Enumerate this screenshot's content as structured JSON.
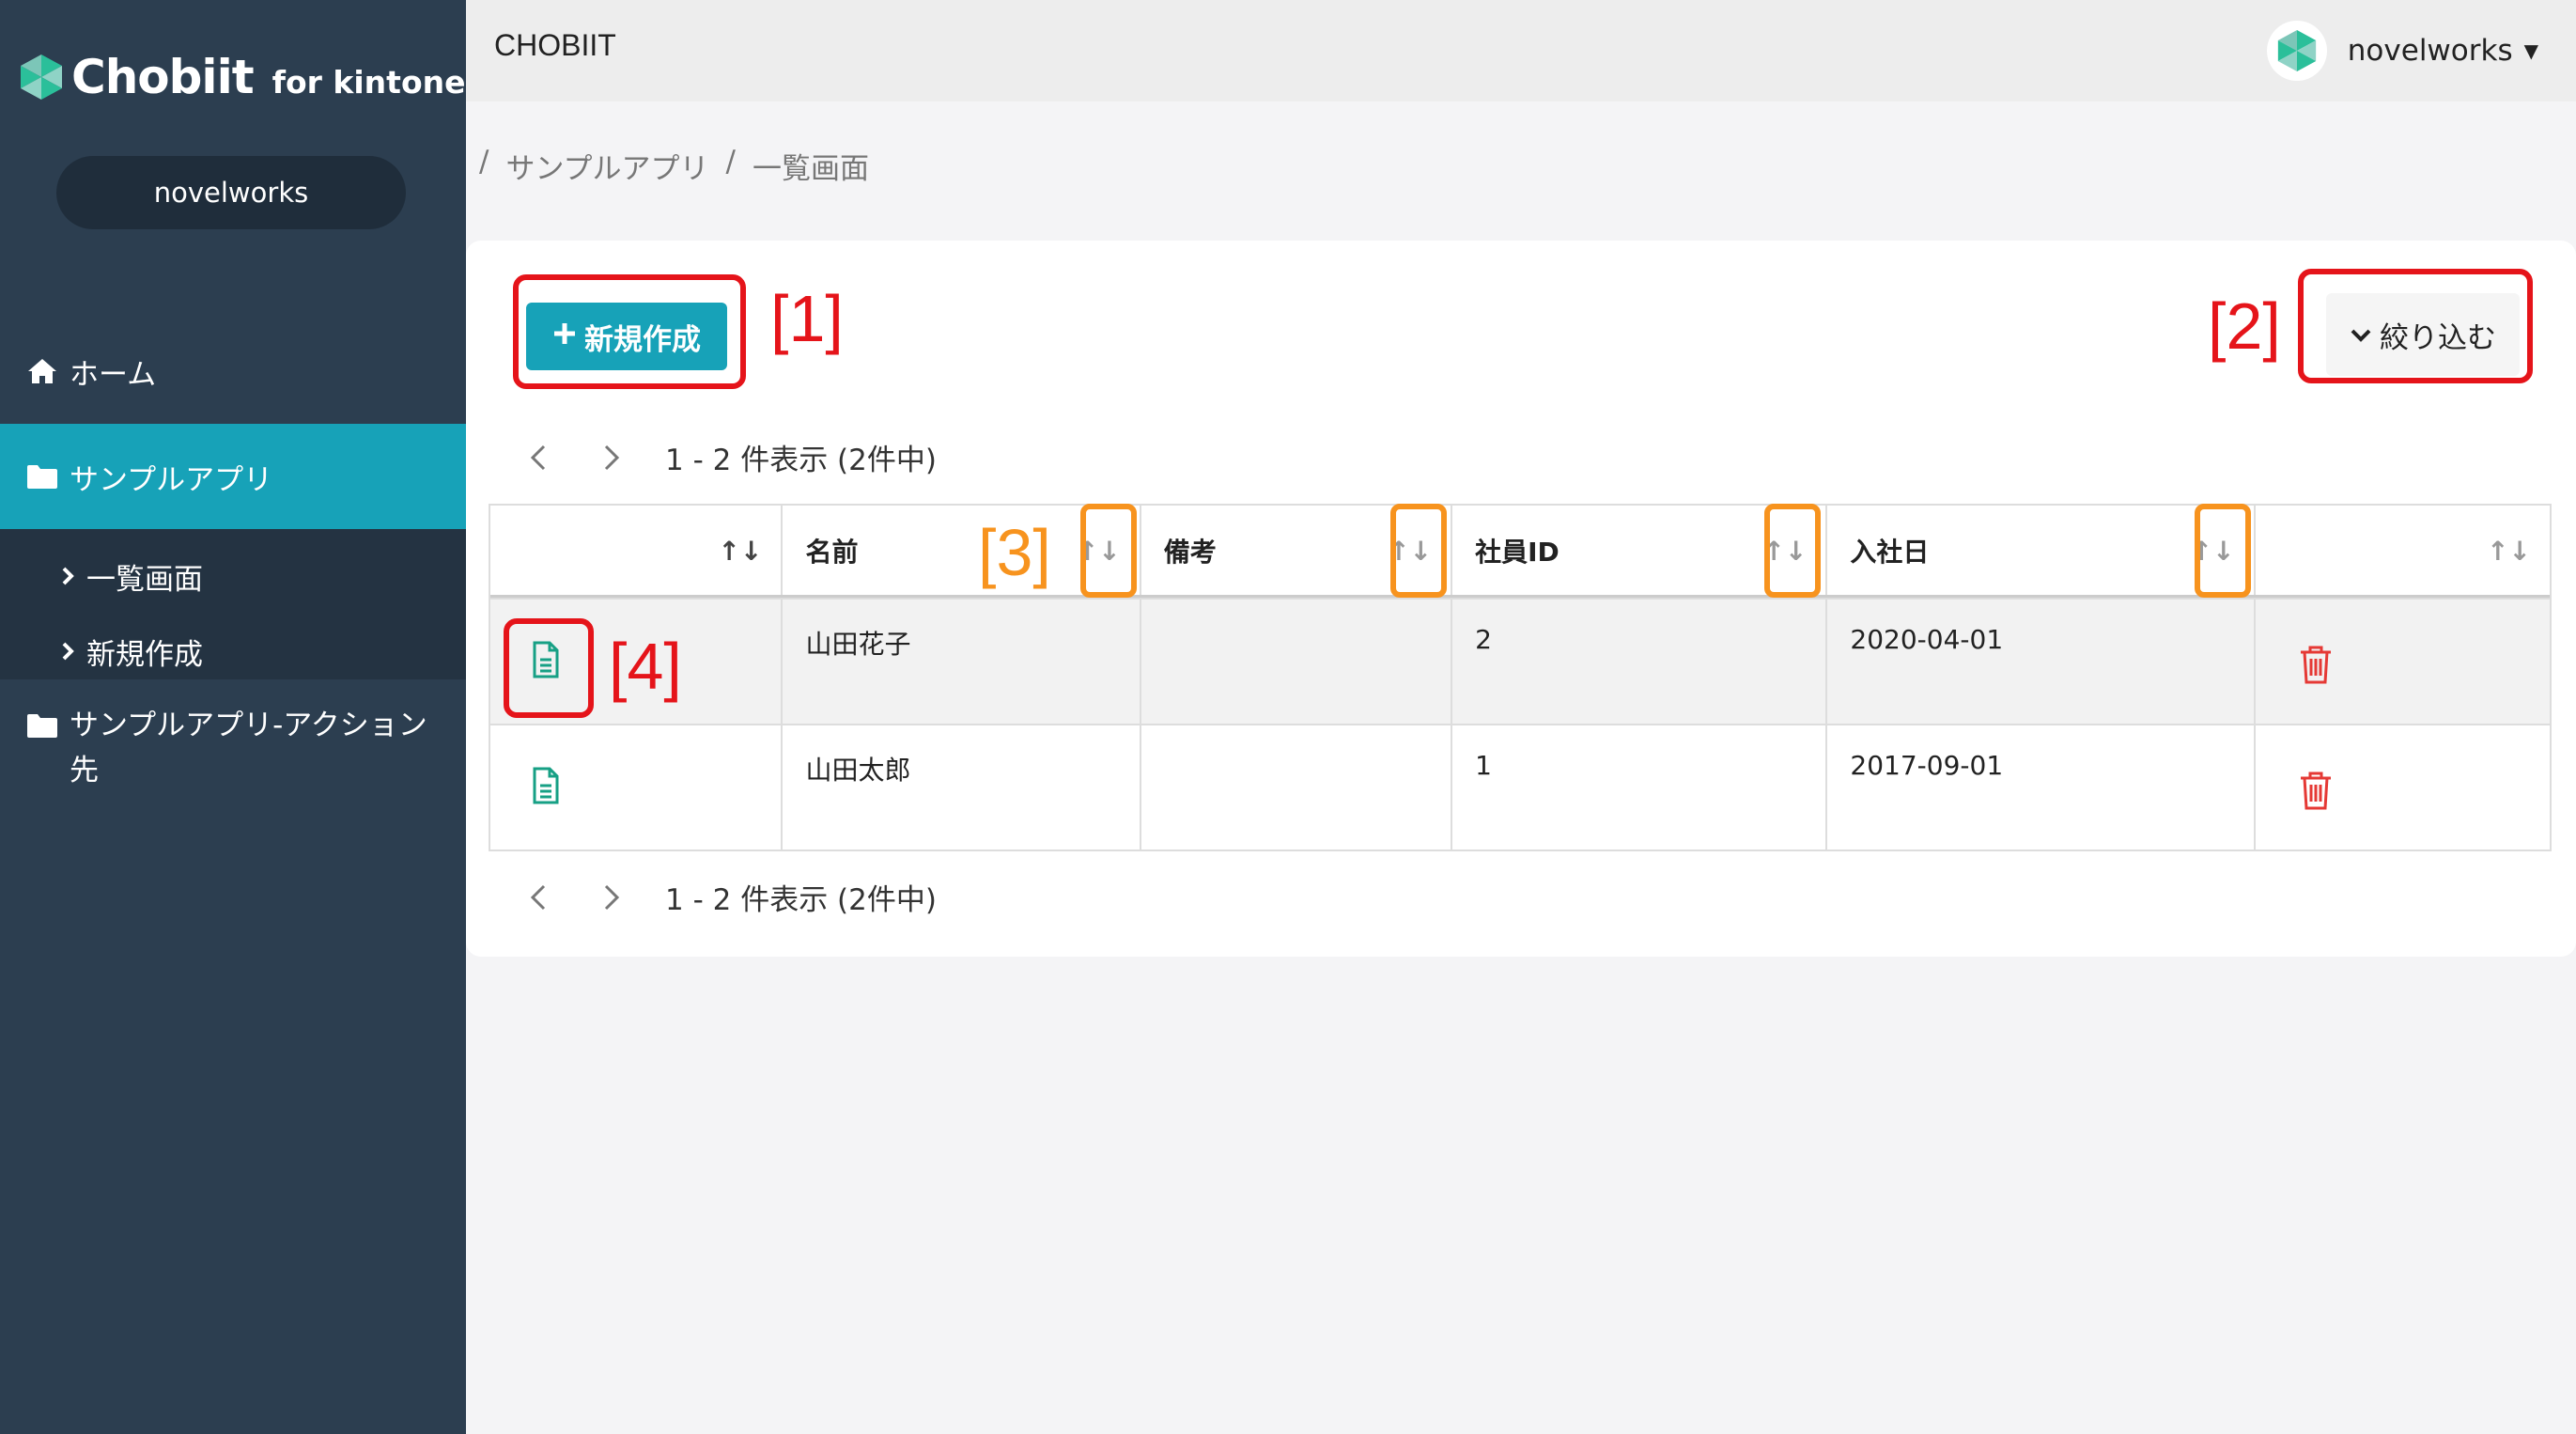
{
  "sidebar": {
    "logo_text": "Chobiit",
    "logo_sub": "for kintone",
    "user": "novelworks",
    "home_label": "ホーム",
    "app_label": "サンプルアプリ",
    "sub_items": [
      "一覧画面",
      "新規作成"
    ],
    "action_label": "サンプルアプリ-アクション先",
    "accent": "#17a2b8"
  },
  "topbar": {
    "title": "CHOBIIT",
    "user": "novelworks"
  },
  "breadcrumb": [
    "/",
    "サンプルアプリ",
    "/",
    "一覧画面"
  ],
  "toolbar": {
    "new_label": "新規作成",
    "filter_label": "絞り込む"
  },
  "pager": {
    "summary": "1 - 2 件表示 (2件中)"
  },
  "table": {
    "headers": [
      "",
      "名前",
      "備考",
      "社員ID",
      "入社日",
      ""
    ],
    "rows": [
      {
        "name": "山田花子",
        "note": "",
        "id": "2",
        "date": "2020-04-01"
      },
      {
        "name": "山田太郎",
        "note": "",
        "id": "1",
        "date": "2017-09-01"
      }
    ]
  },
  "annotations": {
    "a1": "[1]",
    "a2": "[2]",
    "a3": "[3]",
    "a4": "[4]",
    "red": "#e5141a",
    "orange": "#f7931e"
  },
  "icons": {
    "doc": "document-icon",
    "trash": "trash-icon",
    "sort": "sort-arrows-icon"
  }
}
